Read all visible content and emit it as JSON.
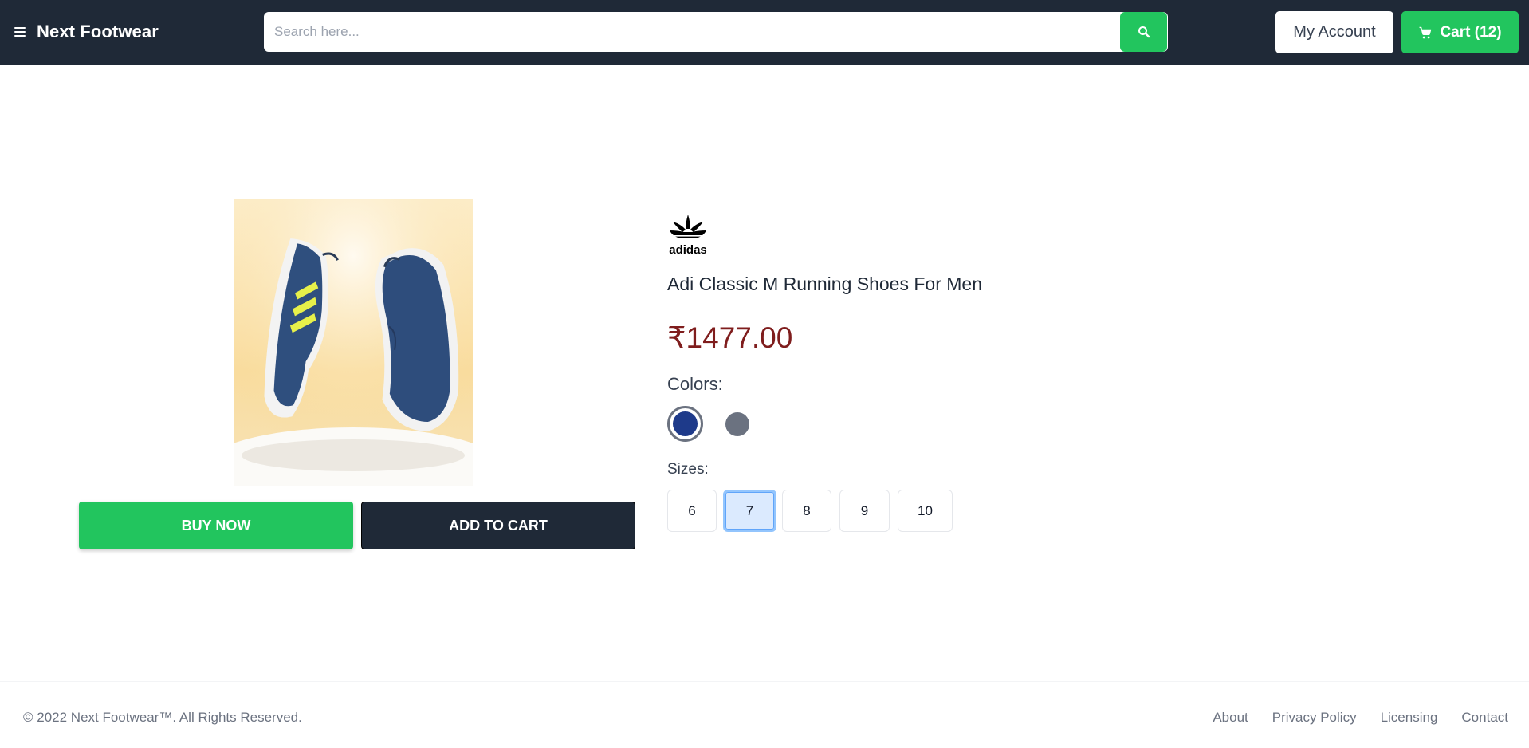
{
  "header": {
    "menu_icon": "hamburger-menu-icon",
    "brand": "Next Footwear",
    "search": {
      "placeholder": "Search here...",
      "value": "",
      "icon": "search-icon"
    },
    "account_label": "My Account",
    "cart": {
      "label": "Cart (12)",
      "icon": "cart-icon"
    }
  },
  "product": {
    "brand_logo": "adidas",
    "title": "Adi Classic M Running Shoes For Men",
    "price": "₹1477.00",
    "colors_label": "Colors:",
    "colors": [
      {
        "name": "navy",
        "hex": "#1e3a8a",
        "selected": true
      },
      {
        "name": "gray",
        "hex": "#6b7280",
        "selected": false
      }
    ],
    "sizes_label": "Sizes:",
    "sizes": [
      "6",
      "7",
      "8",
      "9",
      "10"
    ],
    "selected_size": "7",
    "buy_now": "BUY NOW",
    "add_to_cart": "ADD TO CART"
  },
  "footer": {
    "copyright": "© 2022 Next Footwear™. All Rights Reserved.",
    "links": [
      "About",
      "Privacy Policy",
      "Licensing",
      "Contact"
    ]
  },
  "colors": {
    "header_bg": "#1f2937",
    "accent_green": "#22c55e",
    "price_red": "#7f1d1d"
  }
}
